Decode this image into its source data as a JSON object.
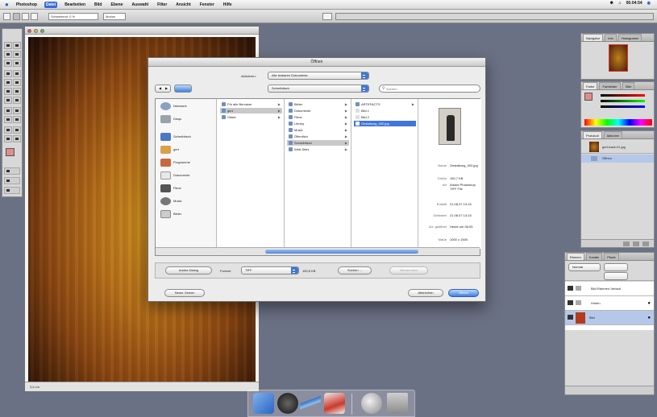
{
  "menubar": {
    "app": "Photoshop",
    "items": [
      "Datei",
      "Bearbeiten",
      "Bild",
      "Ebene",
      "Auswahl",
      "Filter",
      "Ansicht",
      "Fenster",
      "Hilfe"
    ],
    "active": "Datei",
    "clock": "06:04:54"
  },
  "optionsbar": {
    "tool_value": "Schwebend: 0 %",
    "mode": "Modus"
  },
  "document": {
    "status": "3,6 cm"
  },
  "dialog": {
    "title": "Öffnen",
    "show_label": "Aktivieren:",
    "show_value": "Alle lesbaren Dokumente",
    "location_value": "Schreibtisch",
    "search_placeholder": "Suchen",
    "sidebar": [
      "Netzwerk",
      "Disqu",
      "Schreibtisch",
      "gert",
      "Programme",
      "Dokumente",
      "Filme",
      "Musik",
      "Bilder"
    ],
    "col1": [
      "Für alle Benutzer",
      "gert",
      "Gäste"
    ],
    "col2": [
      "Bilder",
      "Dokumente",
      "Filme",
      "Library",
      "Musik",
      "Öffentlich",
      "Schreibtisch",
      "Web-Sites"
    ],
    "col3": [
      "ARTEFACTS",
      "Bild 1",
      "Bild 2",
      "Gestaltung_002.jpg"
    ],
    "col3_selected": "Gestaltung_002.jpg",
    "info": [
      {
        "k": "Name",
        "v": "Gestaltung_002.jpg"
      },
      {
        "k": "Größe",
        "v": "150,7 KB"
      },
      {
        "k": "Art",
        "v": "Adobe Photoshop TIFF File"
      },
      {
        "k": "Erstellt",
        "v": "21.08.07 13:15"
      },
      {
        "k": "Geändert",
        "v": "21.08.07 13:15"
      },
      {
        "k": "Zul. geöffnet",
        "v": "Heute um 06:05"
      },
      {
        "k": "Maße",
        "v": "1000 x 1500"
      }
    ],
    "btn_use_dialog": "Adobe-Dialog",
    "format_label": "Format:",
    "format_value": "TIFF",
    "size_text": "150,6 KB",
    "btn_search": "Suchen ...",
    "btn_disabled": "Wiederholen",
    "btn_new_folder": "Neuer Ordner",
    "btn_cancel": "Abbrechen",
    "btn_open": "Öffnen"
  },
  "palettes": {
    "navigator_tabs": [
      "Navigator",
      "Info",
      "Histogramm"
    ],
    "color_tabs": [
      "Farbe",
      "Farbfelder",
      "Stile"
    ],
    "history_tabs": [
      "Protokoll",
      "Aktionen"
    ],
    "history_items": [
      "gert-back-01.jpg",
      "Öffnen"
    ],
    "layers_tabs": [
      "Ebenen",
      "Kanäle",
      "Pfade"
    ],
    "layers_mode": "Normal",
    "layers": [
      "Bild-Rahmen-Verlauf",
      "Hinten",
      "Bild"
    ]
  },
  "dock": {
    "icons": [
      "finder-icon",
      "dashboard-icon",
      "photoshop-feather-icon",
      "mail-icon",
      "trash-icon"
    ]
  }
}
